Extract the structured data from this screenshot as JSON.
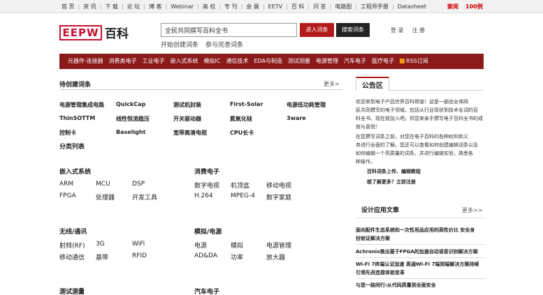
{
  "top_nav": [
    "首 页",
    "资 讯",
    "下 载",
    "论 坛",
    "博 客",
    "Webinar",
    "高 校",
    "专 刊",
    "会 展",
    "EETV",
    "百 科",
    "问 答",
    "电路图",
    "工程师手册",
    "Datasheet"
  ],
  "top_right": [
    "索阅",
    "100例"
  ],
  "logo": {
    "mark": "EEPW",
    "cn": "百科"
  },
  "search": {
    "value": "全民共同撰写百科全书",
    "enter_label": "进入词条",
    "search_label": "搜索词条"
  },
  "sublinks": [
    "开始创建词条",
    "参与完善词条"
  ],
  "account": {
    "login": "登 录",
    "register": "注 册"
  },
  "categories": [
    "元器件·连接器",
    "消费类电子",
    "工业电子",
    "嵌入式系统",
    "模拟IC",
    "通信技术",
    "EDA与制造",
    "测试测量",
    "电源管理",
    "汽车电子",
    "医疗电子"
  ],
  "rss_label": "RSS订阅",
  "pending": {
    "title": "待创建词条",
    "more": "更多>",
    "rows": [
      [
        "电源管理集成电路",
        "QuickCap",
        "测试机封装",
        "First-Solar",
        "电源低功耗管理"
      ],
      [
        "ThinSOTTM",
        "线性恒流稳压",
        "开关驱动器",
        "氮氧化硅",
        "3ware"
      ],
      [
        "控制卡",
        "Baselight",
        "宽带高清电视",
        "CPU长卡"
      ]
    ]
  },
  "classification": {
    "title": "分类列表",
    "groups": [
      {
        "title": "嵌入式系统",
        "rows": [
          [
            "ARM",
            "MCU",
            "DSP"
          ],
          [
            "FPGA",
            "处理器",
            "开发工具"
          ]
        ]
      },
      {
        "title": "消费电子",
        "rows": [
          [
            "数字电视",
            "机顶盒",
            "移动电视"
          ],
          [
            "H.264",
            "MPEG-4",
            "数字家庭"
          ]
        ]
      },
      {
        "title": "无线/通讯",
        "rows": [
          [
            "射频(RF)",
            "3G",
            "WiFi"
          ],
          [
            "移动通信",
            "基带",
            "RFID"
          ]
        ]
      },
      {
        "title": "模拟/电源",
        "rows": [
          [
            "电源",
            "模拟",
            "电源管理"
          ],
          [
            "AD&DA",
            "功率",
            "放大器"
          ]
        ]
      },
      {
        "title": "测试测量",
        "rows": []
      },
      {
        "title": "汽车电子",
        "rows": []
      }
    ]
  },
  "notice": {
    "title": "公告区",
    "lines1": [
      "欢迎来到电子产品世界百科频道！这是一部由全体网",
      "民共同撰写的电子领域，包括从行业现状到技术名词的百",
      "科全书。现在就加入吧，供您来亲手撰写电子百科全书的成",
      "就与喜悦！"
    ],
    "lines2": [
      "在您撰写词条之前，对您在电子百科的各种权利和义",
      "务进行全面的了解。您还可以查看如何创建编辑词条以及",
      "如何编辑一个高质量的词条，并进行编辑实验，熟悉各",
      "种操作。"
    ],
    "link1": "百科词条上传、编辑教程",
    "link2": "想了解更多？立即注册"
  },
  "apps": {
    "title": "设计应用文章",
    "more": "更多>>",
    "articles": [
      [
        "面向配件生态系统和一次性用品应用的高性价比 安全身",
        "份验证解决方案"
      ],
      [
        "Achronix推出基于FPGA的加速自动语音识别解决方案"
      ],
      [
        "Wi-Fi 7终端认证加速 高通Wi-Fi 7端到端解决方案持续",
        "引领先进连接体验变革"
      ],
      [
        "与您一路同行:从代码质量到全面安全"
      ]
    ]
  }
}
